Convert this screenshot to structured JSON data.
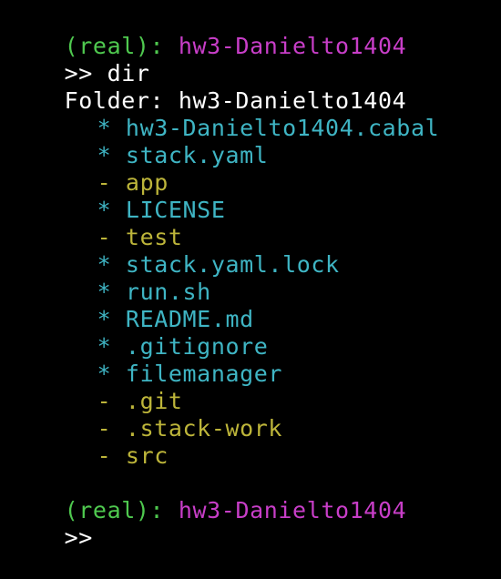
{
  "colors": {
    "background": "#000000",
    "env": "#4fc94f",
    "path": "#c83ec8",
    "text": "#ffffff",
    "file": "#3fb5c4",
    "folder": "#bdb53a"
  },
  "prompt1": {
    "env_open": "(",
    "env_name": "real",
    "env_close": "):",
    "path": "hw3-Danielto1404"
  },
  "command": {
    "prompt": ">>",
    "text": "dir"
  },
  "listing": {
    "header_label": "Folder:",
    "header_value": "hw3-Danielto1404",
    "entries": [
      {
        "marker": "*",
        "name": "hw3-Danielto1404.cabal"
      },
      {
        "marker": "*",
        "name": "stack.yaml"
      },
      {
        "marker": "-",
        "name": "app"
      },
      {
        "marker": "*",
        "name": "LICENSE"
      },
      {
        "marker": "-",
        "name": "test"
      },
      {
        "marker": "*",
        "name": "stack.yaml.lock"
      },
      {
        "marker": "*",
        "name": "run.sh"
      },
      {
        "marker": "*",
        "name": "README.md"
      },
      {
        "marker": "*",
        "name": ".gitignore"
      },
      {
        "marker": "*",
        "name": "filemanager"
      },
      {
        "marker": "-",
        "name": ".git"
      },
      {
        "marker": "-",
        "name": ".stack-work"
      },
      {
        "marker": "-",
        "name": "src"
      }
    ]
  },
  "prompt2": {
    "env_open": "(",
    "env_name": "real",
    "env_close": "):",
    "path": "hw3-Danielto1404",
    "input_prompt": ">>"
  }
}
